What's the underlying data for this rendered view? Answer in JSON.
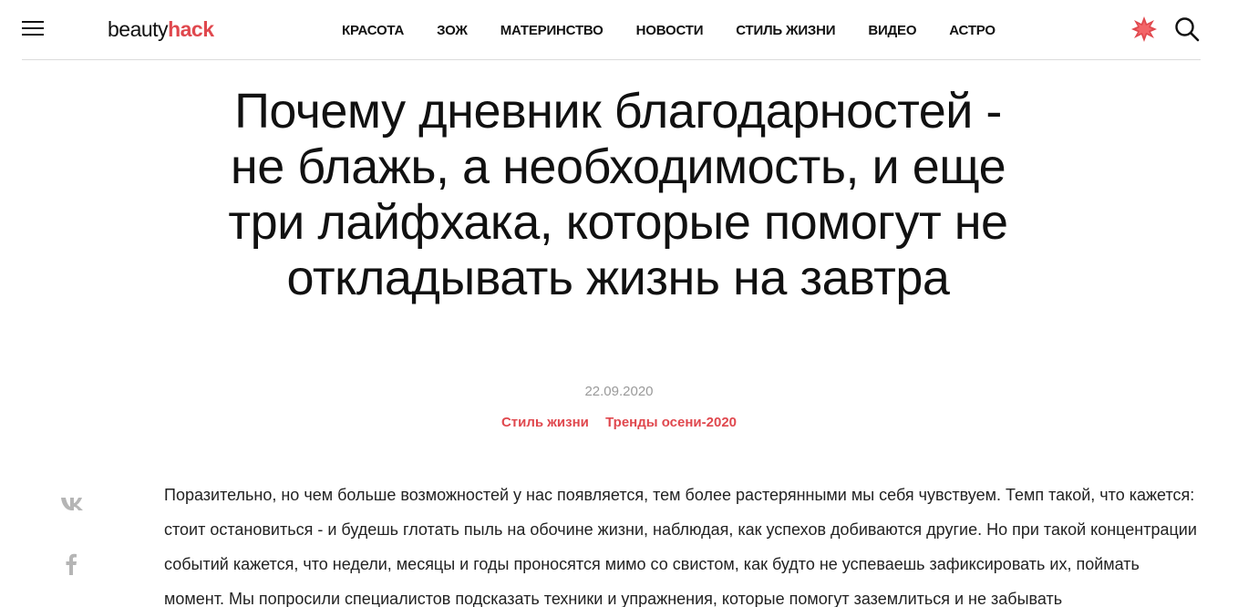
{
  "header": {
    "logo_part1": "beauty",
    "logo_part2": "hack",
    "nav": [
      "КРАСОТА",
      "ЗОЖ",
      "МАТЕРИНСТВО",
      "НОВОСТИ",
      "СТИЛЬ ЖИЗНИ",
      "ВИДЕО",
      "АСТРО"
    ],
    "icons": [
      "menu-icon",
      "star-icon",
      "search-icon"
    ],
    "accent_color": "#e0484e"
  },
  "article": {
    "title": "Почему дневник благодарностей - не блажь, а необходимость, и еще три лайфхака, которые помогут не откладывать жизнь на завтра",
    "date": "22.09.2020",
    "tags": [
      "Стиль жизни",
      "Тренды осени-2020"
    ],
    "body": "Поразительно, но чем больше возможностей у нас появляется, тем более растерянными мы себя чувствуем. Темп такой, что кажется: стоит остановиться - и будешь глотать пыль на обочине жизни, наблюдая, как успехов добиваются другие. Но при такой концентрации событий кажется, что недели, месяцы и годы проносятся мимо со свистом, как будто не успеваешь зафиксировать их, поймать момент. Мы попросили специалистов подсказать техники и упражнения, которые помогут заземлиться и не забывать"
  },
  "share": {
    "icons": [
      "vk-icon",
      "facebook-icon"
    ],
    "icon_color": "#b5b5b5"
  }
}
